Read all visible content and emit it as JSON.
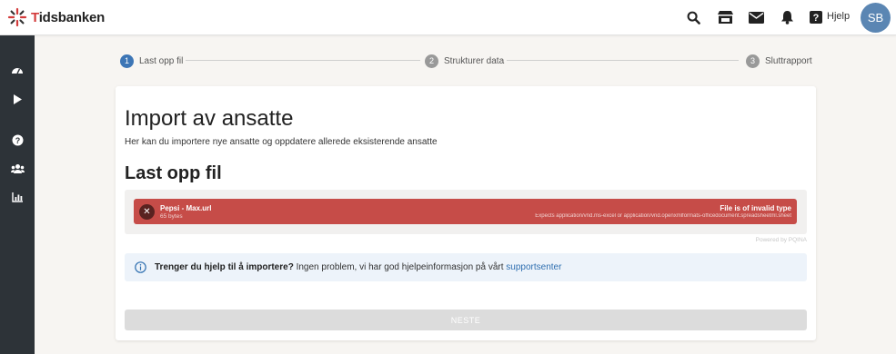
{
  "app": {
    "logo_prefix": "T",
    "logo_rest": "idsbanken"
  },
  "header": {
    "icons": [
      "search-icon",
      "store-icon",
      "mail-icon",
      "bell-icon",
      "question-square-icon"
    ],
    "help_label": "Hjelp",
    "avatar_initials": "SB"
  },
  "sidebar": {
    "icons": [
      "dashboard-icon",
      "play-icon",
      "help-circle-icon",
      "users-icon",
      "bar-chart-icon"
    ]
  },
  "stepper": {
    "steps": [
      {
        "num": "1",
        "label": "Last opp fil",
        "active": true
      },
      {
        "num": "2",
        "label": "Strukturer data",
        "active": false
      },
      {
        "num": "3",
        "label": "Sluttrapport",
        "active": false
      }
    ]
  },
  "page": {
    "title": "Import av ansatte",
    "subtitle": "Her kan du importere nye ansatte og oppdatere allerede eksisterende ansatte",
    "section_title": "Last opp fil"
  },
  "upload": {
    "file_name": "Pepsi - Max.url",
    "file_size": "65 bytes",
    "status": "File is of invalid type",
    "status_detail": "Expects application/vnd.ms-excel or application/vnd.openxmlformats-officedocument.spreadsheetml.sheet",
    "powered_by": "Powered by PQINA",
    "error_color": "#c64c48"
  },
  "info": {
    "strong": "Trenger du hjelp til å importere?",
    "text": " Ingen problem, vi har god hjelpeinformasjon på vårt ",
    "link": "supportsenter"
  },
  "actions": {
    "next_label": "NESTE"
  },
  "colors": {
    "accent": "#3c75b5",
    "sidebar": "#2d3338",
    "avatar": "#5b86b3"
  }
}
